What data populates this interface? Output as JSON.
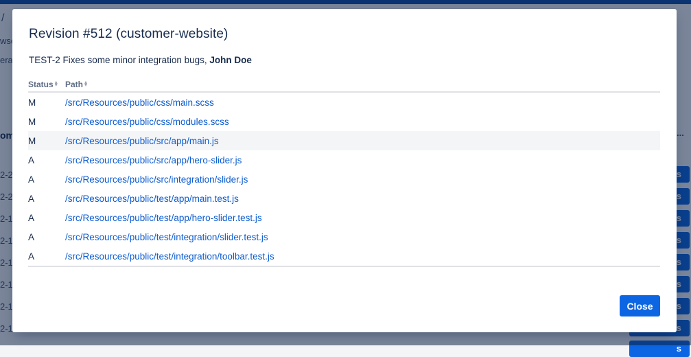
{
  "modal": {
    "title": "Revision #512 (customer-website)",
    "commit_message": "TEST-2 Fixes some minor integration bugs,",
    "author": "John Doe",
    "columns": {
      "status": "Status",
      "path": "Path"
    },
    "files": [
      {
        "status": "M",
        "path": "/src/Resources/public/css/main.scss"
      },
      {
        "status": "M",
        "path": "/src/Resources/public/css/modules.scss"
      },
      {
        "status": "M",
        "path": "/src/Resources/public/src/app/main.js"
      },
      {
        "status": "A",
        "path": "/src/Resources/public/src/app/hero-slider.js"
      },
      {
        "status": "A",
        "path": "/src/Resources/public/src/integration/slider.js"
      },
      {
        "status": "A",
        "path": "/src/Resources/public/test/app/main.test.js"
      },
      {
        "status": "A",
        "path": "/src/Resources/public/test/app/hero-slider.test.js"
      },
      {
        "status": "A",
        "path": "/src/Resources/public/test/integration/slider.test.js"
      },
      {
        "status": "A",
        "path": "/src/Resources/public/test/integration/toolbar.test.js"
      }
    ],
    "close_label": "Close"
  },
  "background": {
    "breadcrumb_sep": "/",
    "fragments": [
      "wse",
      "erat",
      "om",
      "..."
    ],
    "row_dates": [
      "2-2",
      "2-2",
      "2-1",
      "2-1",
      "2-1",
      "2-1",
      "2-1",
      "2-1"
    ],
    "button_label": "s"
  }
}
